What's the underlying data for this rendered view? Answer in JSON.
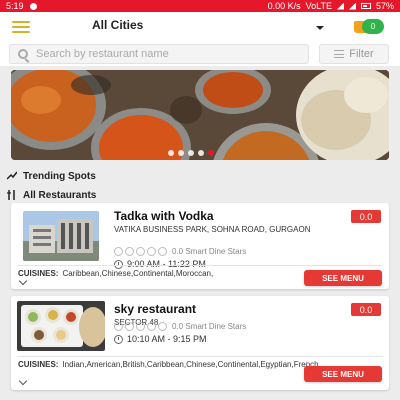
{
  "status_bar": {
    "time": "5:19",
    "network_speed": "0.00 K/s",
    "network_type": "VoLTE",
    "battery": "57%"
  },
  "header": {
    "city": "All Cities",
    "cart_count": "0"
  },
  "search": {
    "placeholder": "Search by restaurant name",
    "filter_label": "Filter"
  },
  "banner": {
    "slides": 5,
    "active_slide": 5
  },
  "sections": {
    "trending": "Trending Spots",
    "all_restaurants": "All Restaurants"
  },
  "restaurants": [
    {
      "name": "Tadka with Vodka",
      "address": "VATIKA BUSINESS PARK, SOHNA ROAD, GURGAON",
      "rating_text": "0.0 Smart Dine Stars",
      "hours": "9:00 AM - 11:22 PM",
      "score": "0.0",
      "cuisines_label": "CUISINES:",
      "cuisines": "Caribbean,Chinese,Continental,Moroccan,",
      "see_menu": "SEE MENU"
    },
    {
      "name": "sky restaurant",
      "address": "SECTOR 48",
      "rating_text": "0.0 Smart Dine Stars",
      "hours": "10:10 AM - 9:15 PM",
      "score": "0.0",
      "cuisines_label": "CUISINES:",
      "cuisines": "Indian,American,British,Caribbean,Chinese,Continental,Egyptian,French,",
      "see_menu": "SEE MENU"
    }
  ],
  "colors": {
    "status_bar": "#e5182b",
    "accent_red": "#e53935",
    "menu_icon": "#d6b12a",
    "cart_badge": "#2fb34a"
  }
}
